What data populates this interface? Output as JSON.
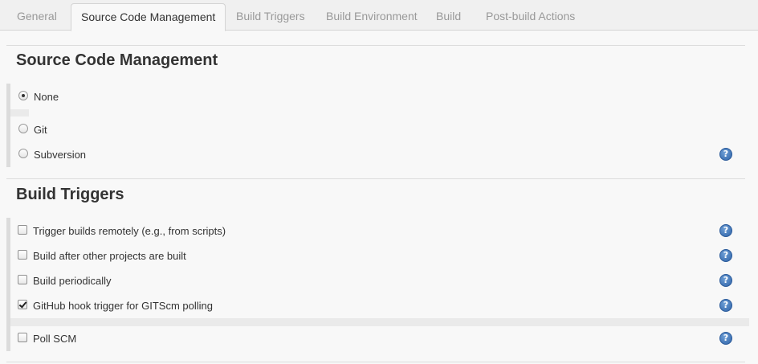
{
  "tabs": [
    {
      "label": "General"
    },
    {
      "label": "Source Code Management",
      "active": true
    },
    {
      "label": "Build Triggers"
    },
    {
      "label": "Build Environment"
    },
    {
      "label": "Build"
    },
    {
      "label": "Post-build Actions"
    }
  ],
  "scm": {
    "title": "Source Code Management",
    "options": [
      {
        "label": "None",
        "checked": true
      },
      {
        "label": "Git",
        "checked": false
      },
      {
        "label": "Subversion",
        "checked": false
      }
    ]
  },
  "triggers": {
    "title": "Build Triggers",
    "options": [
      {
        "label": "Trigger builds remotely (e.g., from scripts)",
        "checked": false
      },
      {
        "label": "Build after other projects are built",
        "checked": false
      },
      {
        "label": "Build periodically",
        "checked": false
      },
      {
        "label": "GitHub hook trigger for GITScm polling",
        "checked": true
      },
      {
        "label": "Poll SCM",
        "checked": false
      }
    ]
  },
  "help_icon_glyph": "?",
  "colors": {
    "accent_help": "#2f63a8",
    "tab_inactive": "#999999",
    "text": "#333333"
  }
}
